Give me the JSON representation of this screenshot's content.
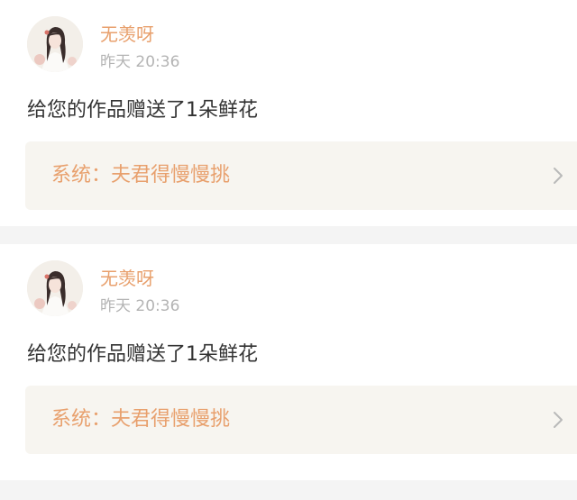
{
  "feed": {
    "items": [
      {
        "username": "无羡呀",
        "time": "昨天 20:36",
        "message": "给您的作品赠送了1朵鲜花",
        "system_link": "系统：夫君得慢慢挑",
        "avatar_icon": "user-avatar-icon",
        "chevron_icon": "chevron-right-icon"
      },
      {
        "username": "无羡呀",
        "time": "昨天 20:36",
        "message": "给您的作品赠送了1朵鲜花",
        "system_link": "系统：夫君得慢慢挑",
        "avatar_icon": "user-avatar-icon",
        "chevron_icon": "chevron-right-icon"
      }
    ]
  },
  "colors": {
    "accent": "#e8a06d",
    "timestamp": "#b4b4b4",
    "text": "#333333",
    "system_box": "#f7f5f0",
    "background": "#f4f4f4"
  }
}
